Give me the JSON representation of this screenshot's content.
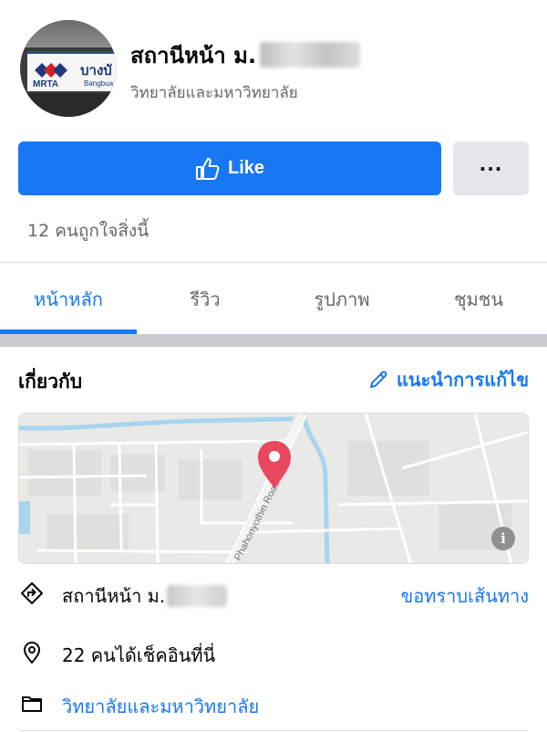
{
  "header": {
    "title": "สถานีหน้า ม.",
    "category": "วิทยาลัยและมหาวิทยาลัย",
    "avatar": {
      "sign_brand": "MRTA",
      "sign_thai": "บางบั",
      "sign_english": "Bangbua"
    }
  },
  "actions": {
    "like_label": "Like",
    "more_label": "···"
  },
  "likes": {
    "text": "12 คนถูกใจสิ่งนี้"
  },
  "tabs": [
    {
      "label": "หน้าหลัก",
      "active": true
    },
    {
      "label": "รีวิว",
      "active": false
    },
    {
      "label": "รูปภาพ",
      "active": false
    },
    {
      "label": "ชุมชน",
      "active": false
    }
  ],
  "about": {
    "title": "เกี่ยวกับ",
    "suggest_edit": "แนะนำการแก้ไข"
  },
  "map": {
    "road_label": "Phahonyothin Road",
    "info_glyph": "i"
  },
  "info_rows": {
    "directions": {
      "text": "สถานีหน้า ม.",
      "action": "ขอทราบเส้นทาง",
      "icon": "directions-icon"
    },
    "checkins": {
      "text": "22 คนได้เช็คอินที่นี่",
      "icon": "location-pin-icon"
    },
    "category": {
      "text": "วิทยาลัยและมหาวิทยาลัย",
      "icon": "category-icon"
    }
  },
  "colors": {
    "primary": "#1877f2",
    "secondary_bg": "#e4e6eb",
    "muted_text": "#65676b",
    "pin": "#e8475f"
  }
}
